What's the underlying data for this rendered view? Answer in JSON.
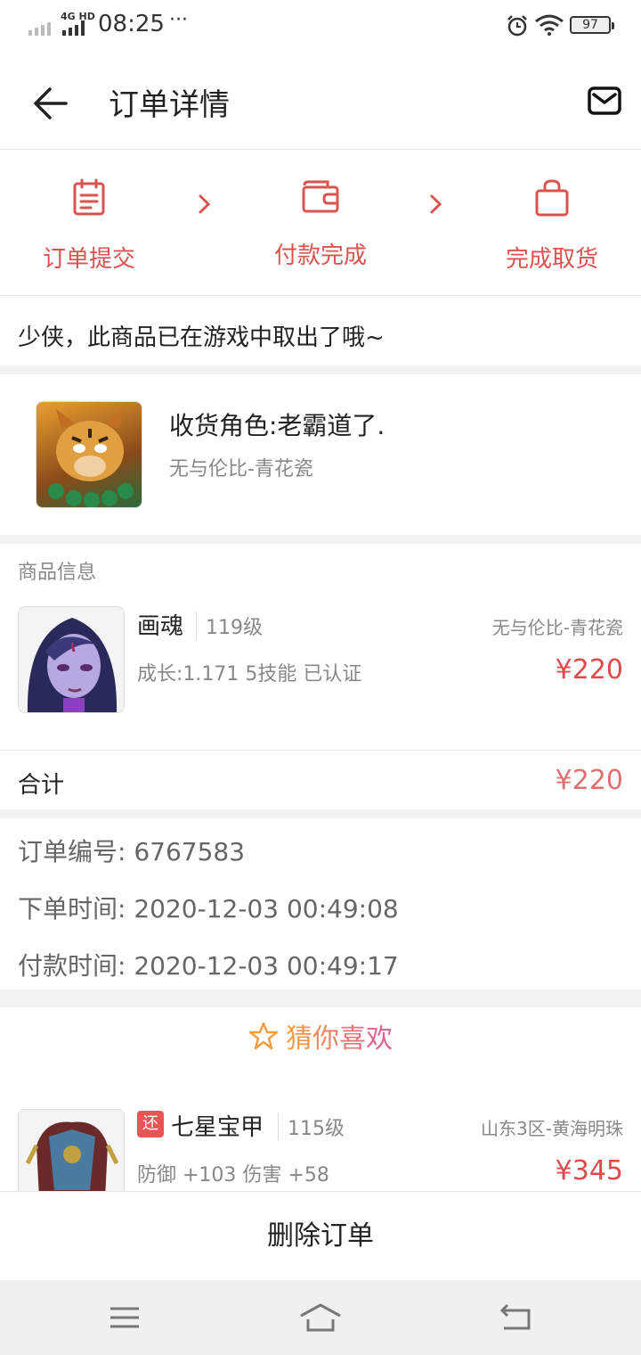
{
  "status_bar": {
    "network": "4G HD",
    "time": "08:25",
    "dots": "···",
    "battery": "97"
  },
  "header": {
    "title": "订单详情"
  },
  "steps": [
    {
      "label": "订单提交",
      "icon": "clipboard-icon"
    },
    {
      "label": "付款完成",
      "icon": "wallet-icon"
    },
    {
      "label": "完成取货",
      "icon": "bag-icon"
    }
  ],
  "notice": "少侠，此商品已在游戏中取出了哦~",
  "receiver": {
    "role": "收货角色:老霸道了.",
    "server": "无与伦比-青花瓷"
  },
  "goods": {
    "section_title": "商品信息",
    "name": "画魂",
    "level": "119级",
    "server": "无与伦比-青花瓷",
    "desc": "成长:1.171 5技能 已认证",
    "price": "¥220"
  },
  "total": {
    "label": "合计",
    "value": "¥220"
  },
  "order_info": [
    {
      "text": "订单编号:  6767583"
    },
    {
      "text": "下单时间:  2020-12-03 00:49:08"
    },
    {
      "text": "付款时间:  2020-12-03 00:49:17"
    }
  ],
  "recommend": {
    "title": "猜你喜欢",
    "item": {
      "badge": "还",
      "name": "七星宝甲",
      "level": "115级",
      "server": "山东3区-黄海明珠",
      "desc": "防御 +103 伤害 +58",
      "price": "¥345"
    }
  },
  "actions": {
    "delete": "删除订单"
  },
  "colors": {
    "accent": "#d9534f",
    "price": "#e04a4a"
  }
}
